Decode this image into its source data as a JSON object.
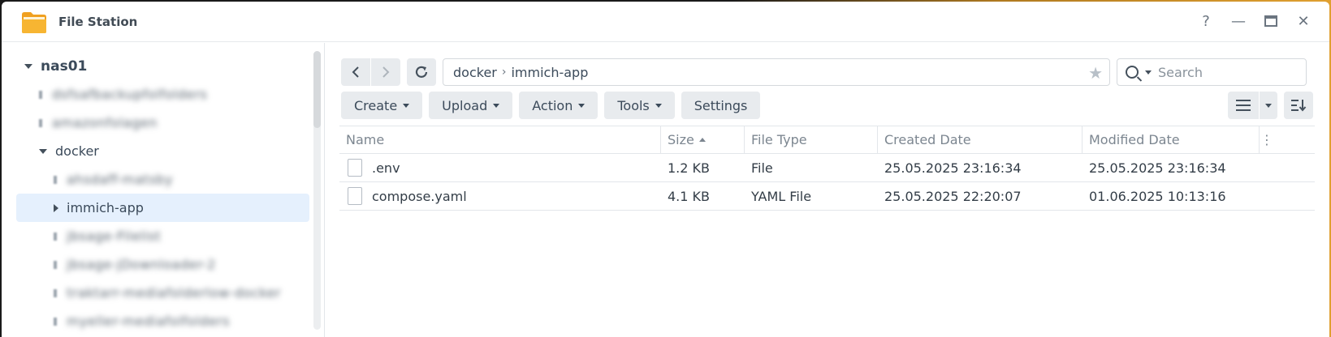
{
  "window": {
    "title": "File Station",
    "controls": [
      "?",
      "—",
      "🗖",
      "✕"
    ]
  },
  "sidebar": {
    "root": "nas01",
    "items": [
      {
        "label": "dsfsafbackupfolfolders",
        "blurred": true,
        "level": 1
      },
      {
        "label": "amazonfolagen",
        "blurred": true,
        "level": 1
      },
      {
        "label": "docker",
        "blurred": false,
        "level": 1,
        "expanded": true
      },
      {
        "label": "ahsdaff-matsby",
        "blurred": true,
        "level": 2
      },
      {
        "label": "immich-app",
        "blurred": false,
        "level": 2,
        "selected": true
      },
      {
        "label": "jbsage-Filelist",
        "blurred": true,
        "level": 2
      },
      {
        "label": "jbsage-jDownloader-2",
        "blurred": true,
        "level": 2
      },
      {
        "label": "traktarr-mediafolderlow-docker",
        "blurred": true,
        "level": 2
      },
      {
        "label": "myeller-mediafolfolders",
        "blurred": true,
        "level": 2
      }
    ]
  },
  "path": {
    "segments": [
      "docker",
      "immich-app"
    ]
  },
  "search": {
    "placeholder": "Search"
  },
  "toolbar": {
    "create": "Create",
    "upload": "Upload",
    "action": "Action",
    "tools": "Tools",
    "settings": "Settings"
  },
  "table": {
    "headers": {
      "name": "Name",
      "size": "Size",
      "type": "File Type",
      "created": "Created Date",
      "modified": "Modified Date"
    },
    "rows": [
      {
        "name": ".env",
        "size": "1.2 KB",
        "type": "File",
        "created": "25.05.2025 23:16:34",
        "modified": "25.05.2025 23:16:34"
      },
      {
        "name": "compose.yaml",
        "size": "4.1 KB",
        "type": "YAML File",
        "created": "25.05.2025 22:20:07",
        "modified": "01.06.2025 10:13:16"
      }
    ]
  },
  "colors": {
    "selected_bg": "#e5f0fd",
    "button_bg": "#e8ebee"
  }
}
